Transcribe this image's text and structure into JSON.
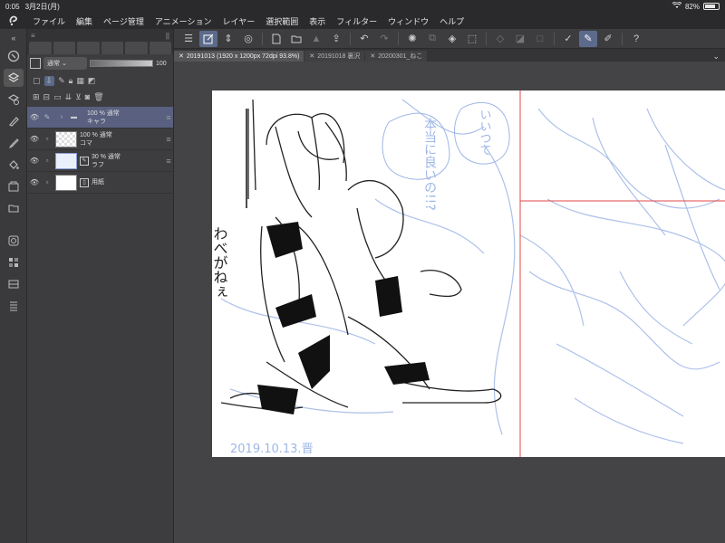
{
  "status": {
    "time": "0:05",
    "date": "3月2日(月)",
    "battery": "82%",
    "battery_level": 0.82,
    "wifi_icon": "wifi-icon"
  },
  "menu": {
    "app_icon": "clip-studio-icon",
    "items": [
      "ファイル",
      "編集",
      "ページ管理",
      "アニメーション",
      "レイヤー",
      "選択範囲",
      "表示",
      "フィルター",
      "ウィンドウ",
      "ヘルプ"
    ]
  },
  "layer_panel": {
    "blend_mode": "通常",
    "opacity": "100",
    "layers": [
      {
        "opacity_mode": "100 % 通常",
        "name": "キャラ",
        "type": "folder",
        "selected": true
      },
      {
        "opacity_mode": "100 % 通常",
        "name": "コマ",
        "type": "raster",
        "selected": false
      },
      {
        "opacity_mode": "30 % 通常",
        "name": "ラフ",
        "type": "sketch",
        "selected": false
      },
      {
        "opacity_mode": "",
        "name": "用紙",
        "type": "paper",
        "selected": false
      }
    ]
  },
  "tabs": [
    {
      "label": "20191013 (1920 x 1200px 72dpi 93.8%)",
      "active": true
    },
    {
      "label": "20191018 裏沢",
      "active": false
    },
    {
      "label": "20200301_ねこ",
      "active": false
    }
  ],
  "canvas": {
    "handwriting_left": "わべがねぇ",
    "handwriting_bubble1": "本当に良いの!!?",
    "handwriting_bubble2": "いいつて",
    "signature": "2019.10.13.晋",
    "guide_color": "#e04848",
    "sketch_color": "#9fb6e6"
  }
}
